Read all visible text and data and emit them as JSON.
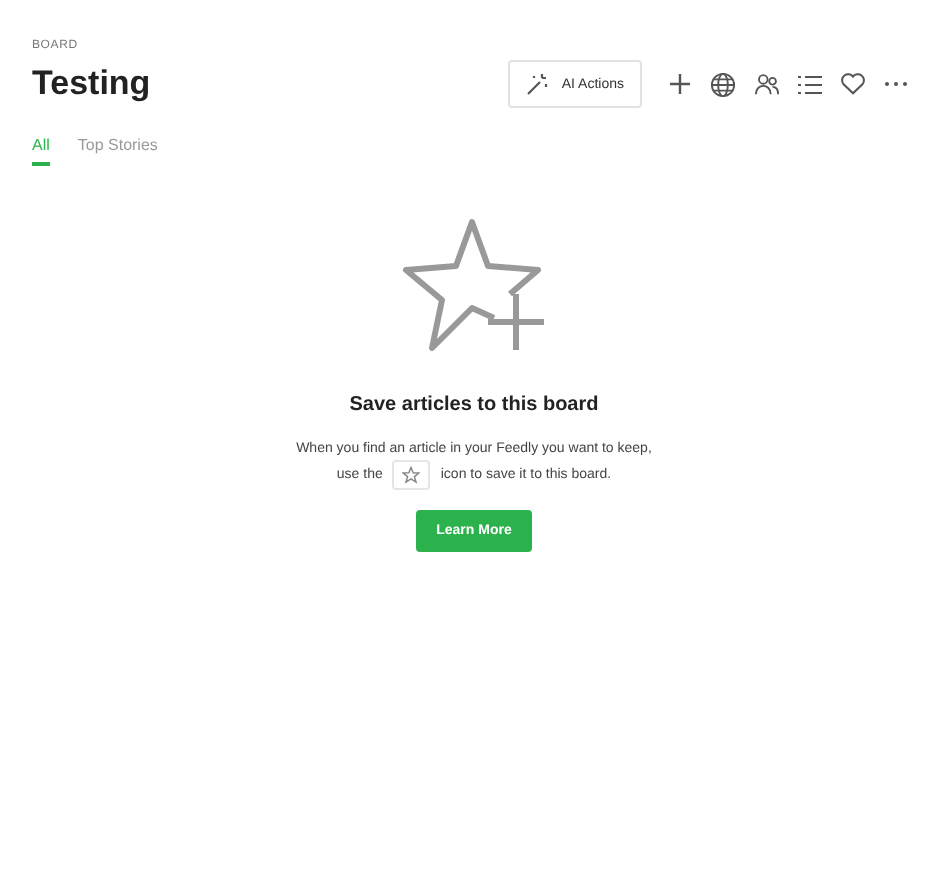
{
  "header": {
    "eyebrow": "BOARD",
    "title": "Testing",
    "ai_button": "AI Actions"
  },
  "tabs": [
    {
      "label": "All",
      "selected": true
    },
    {
      "label": "Top Stories",
      "selected": false
    }
  ],
  "empty_state": {
    "heading": "Save articles to this board",
    "line_1": "When you find an article in your Feedly you want to keep,",
    "line_2_before": "use the",
    "line_2_after": "icon to save it to this board.",
    "button": "Learn More"
  }
}
